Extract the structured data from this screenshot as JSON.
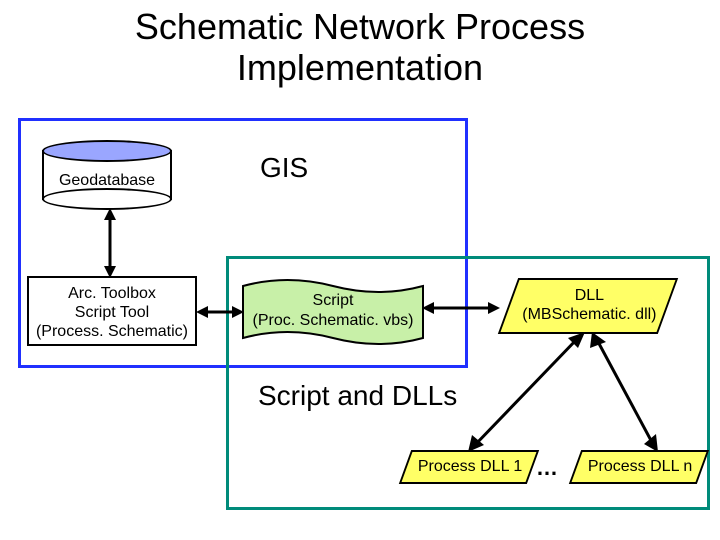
{
  "title_line1": "Schematic Network Process",
  "title_line2": "Implementation",
  "gis_label": "GIS",
  "sd_label": "Script and DLLs",
  "geodatabase_label": "Geodatabase",
  "arctoolbox_line1": "Arc. Toolbox",
  "arctoolbox_line2": "Script Tool",
  "arctoolbox_line3": "(Process. Schematic)",
  "script_line1": "Script",
  "script_line2": "(Proc. Schematic. vbs)",
  "dll_line1": "DLL",
  "dll_line2": "(MBSchematic. dll)",
  "proc_dll_1": "Process DLL 1",
  "proc_dll_n": "Process DLL n",
  "dots": "…"
}
